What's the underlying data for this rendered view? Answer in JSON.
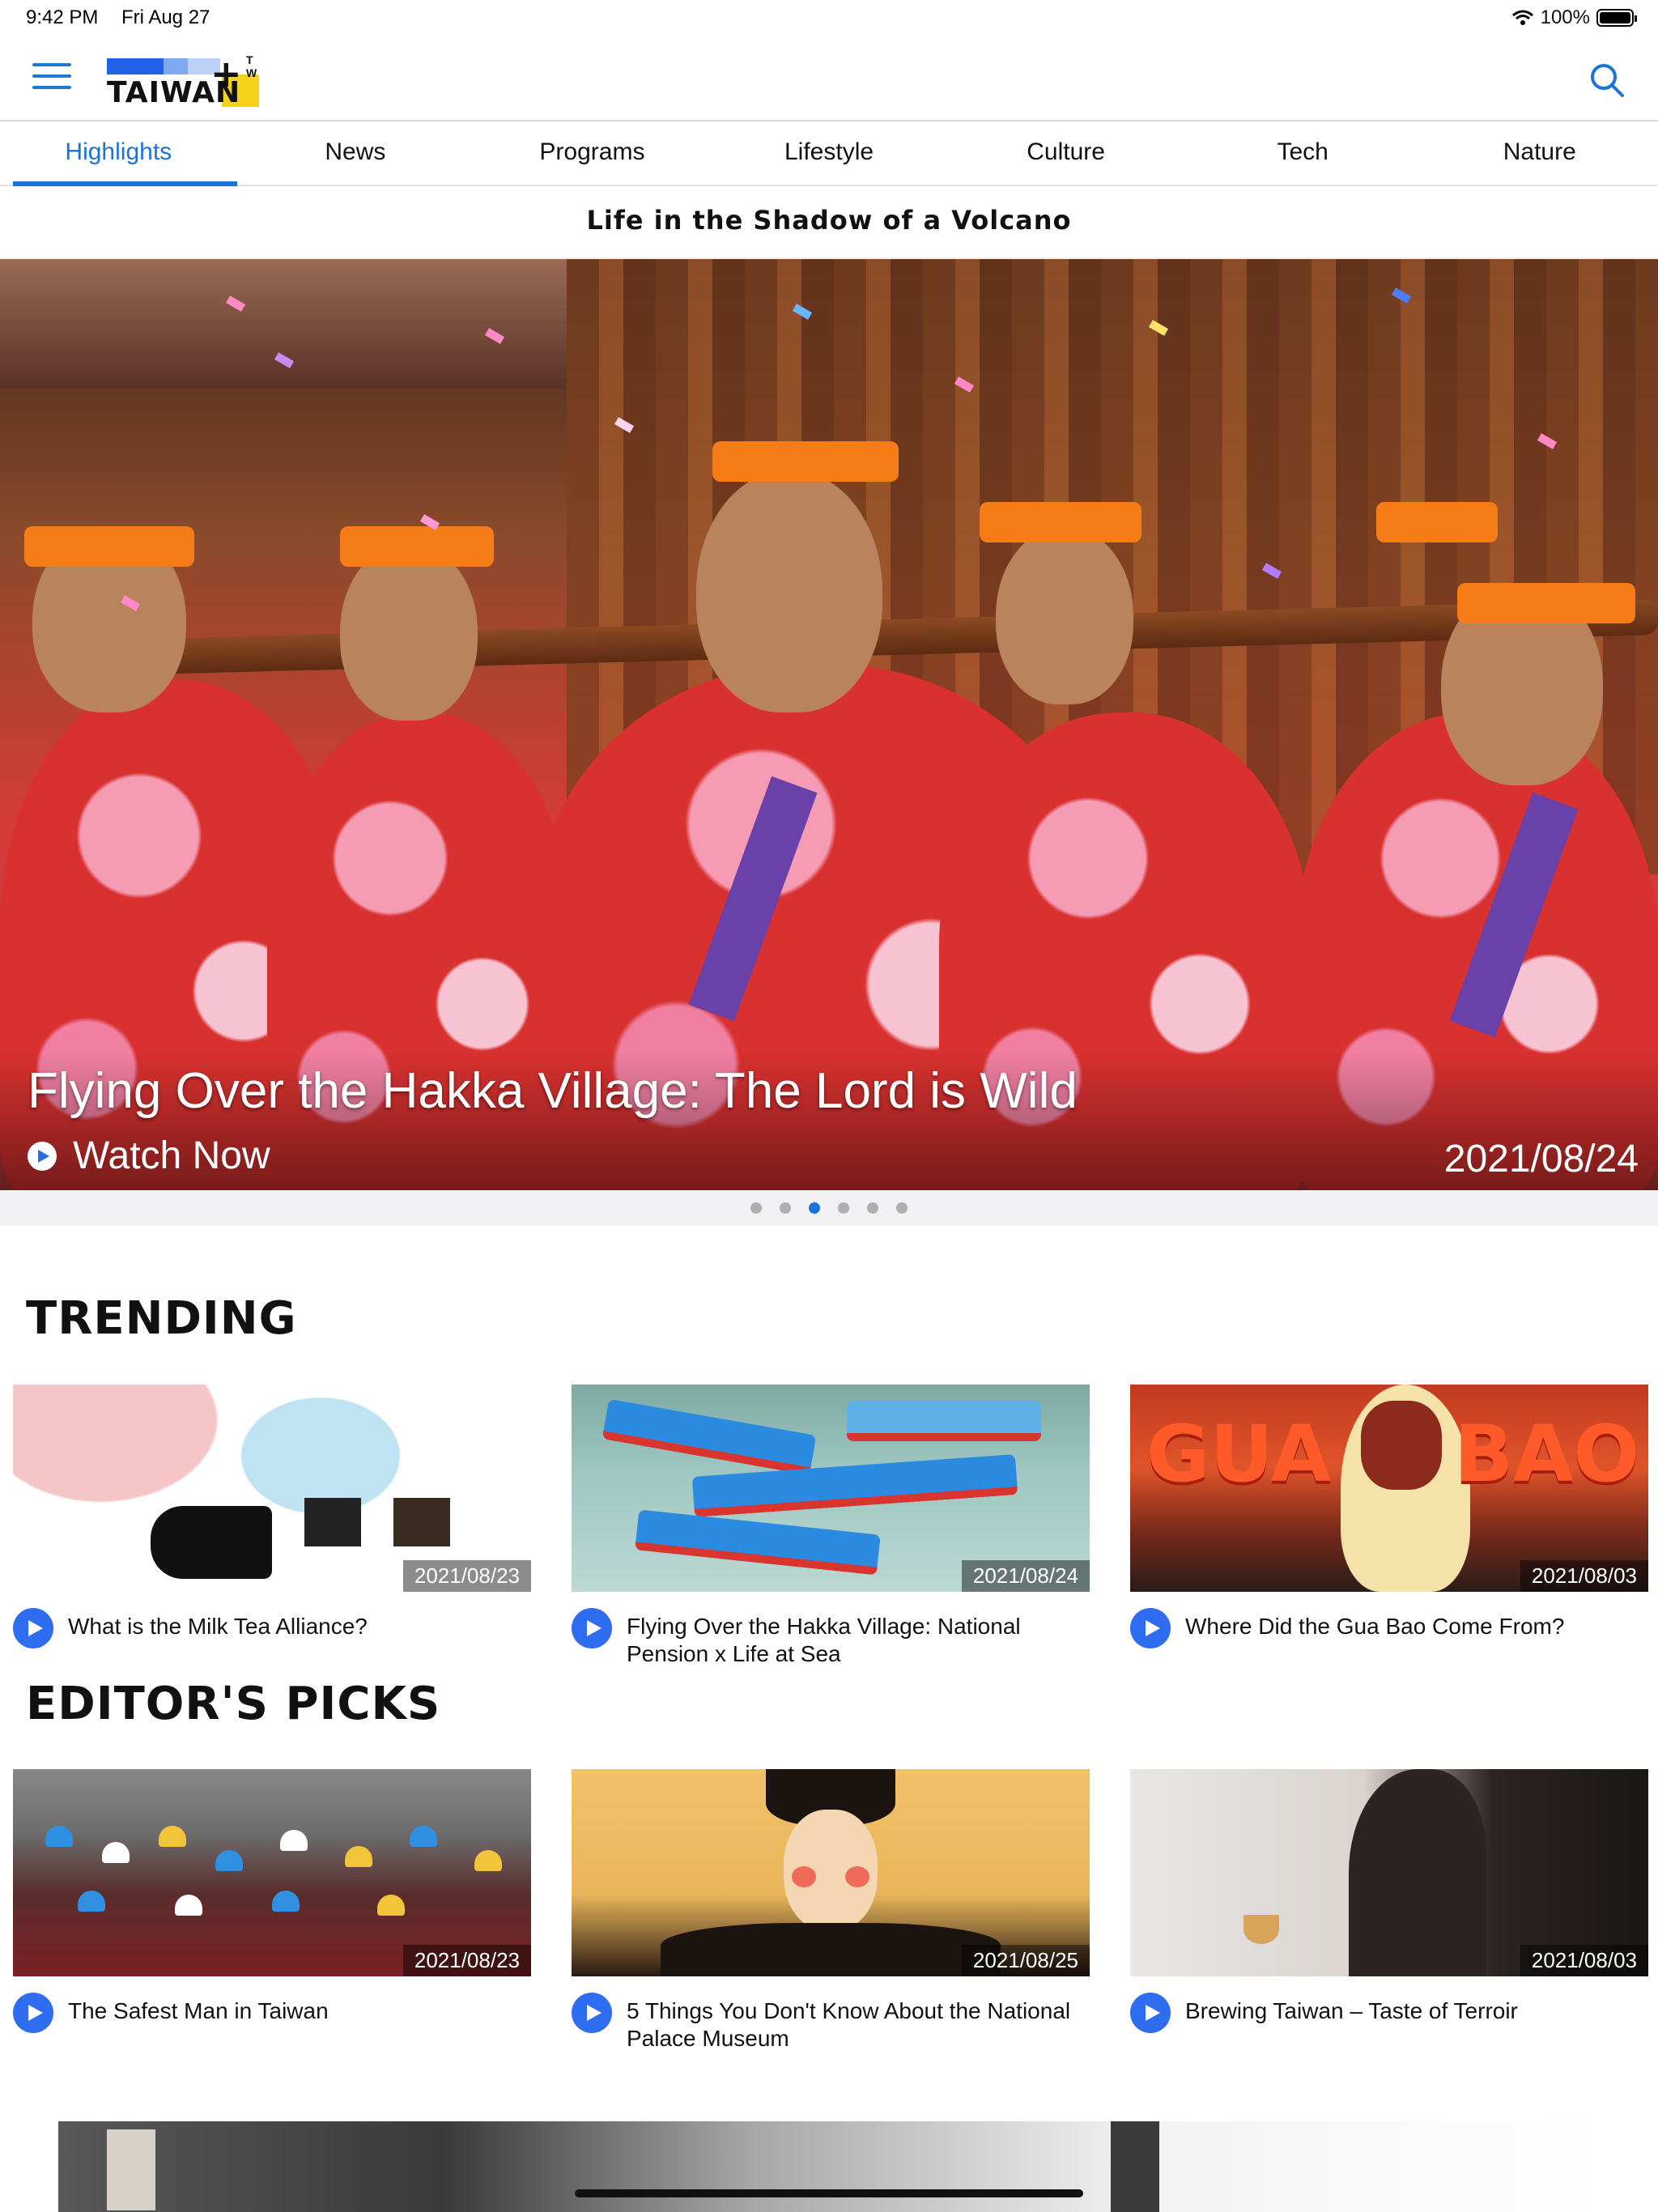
{
  "status_bar": {
    "time": "9:42 PM",
    "date": "Fri Aug 27",
    "battery": "100%"
  },
  "header": {
    "logo_text": "TAIWAN",
    "logo_superscript": "T W"
  },
  "tabs": [
    {
      "label": "Highlights",
      "active": true
    },
    {
      "label": "News"
    },
    {
      "label": "Programs"
    },
    {
      "label": "Lifestyle"
    },
    {
      "label": "Culture"
    },
    {
      "label": "Tech"
    },
    {
      "label": "Nature"
    }
  ],
  "hero": {
    "heading": "Life in the Shadow of a Volcano",
    "title": "Flying Over the Hakka Village: The Lord is Wild",
    "watch_label": "Watch Now",
    "date": "2021/08/24",
    "carousel": {
      "count": 6,
      "active_index": 2
    }
  },
  "trending": {
    "title": "TRENDING",
    "items": [
      {
        "caption": "What is the Milk Tea Alliance?",
        "date": "2021/08/23"
      },
      {
        "caption": "Flying Over the Hakka Village: National Pension x Life at Sea",
        "date": "2021/08/24"
      },
      {
        "caption": "Where Did the Gua Bao Come From?",
        "date": "2021/08/03",
        "thumb_text": [
          "GUA",
          "BAO"
        ]
      }
    ]
  },
  "editors_picks": {
    "title": "EDITOR'S PICKS",
    "items": [
      {
        "caption": "The Safest Man in Taiwan",
        "date": "2021/08/23"
      },
      {
        "caption": "5 Things You Don't Know About the National Palace Museum",
        "date": "2021/08/25"
      },
      {
        "caption": "Brewing Taiwan – Taste of Terroir",
        "date": "2021/08/03"
      }
    ]
  },
  "colors": {
    "accent": "#1a73d9",
    "play": "#2f6df0",
    "logo_blue": "#2061e8",
    "logo_yellow": "#f5d21a"
  }
}
